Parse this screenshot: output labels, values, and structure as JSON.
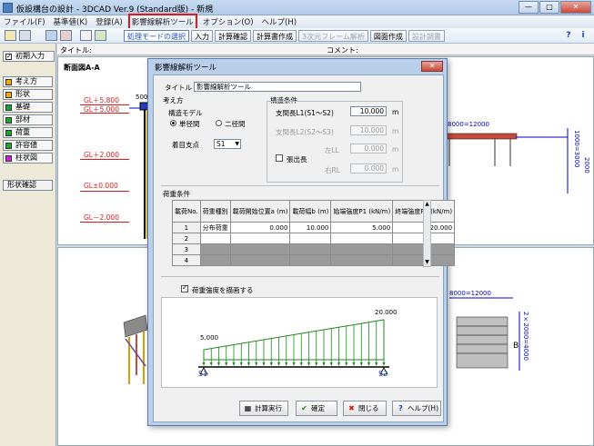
{
  "window": {
    "title": "仮設構台の設計 - 3DCAD Ver.9 (Standard版) - 新規",
    "buttons": {
      "minimize": "—",
      "maximize": "□",
      "close": "✕"
    }
  },
  "menu": [
    {
      "label": "ファイル(F)"
    },
    {
      "label": "基準値(K)"
    },
    {
      "label": "登録(A)"
    },
    {
      "label": "影響線解析ツール",
      "highlighted": true
    },
    {
      "label": "オプション(O)"
    },
    {
      "label": "ヘルプ(H)"
    }
  ],
  "toolbar": {
    "tabs": [
      {
        "label": "処理モードの選択",
        "state": "active"
      },
      {
        "label": "入力",
        "state": "normal"
      },
      {
        "label": "計算確認",
        "state": "normal"
      },
      {
        "label": "計算書作成",
        "state": "normal"
      },
      {
        "label": "3次元フレーム解析",
        "state": "disabled"
      },
      {
        "label": "図面作成",
        "state": "normal"
      },
      {
        "label": "設計調書",
        "state": "disabled"
      }
    ],
    "help_glyph": "?",
    "info_glyph": "i"
  },
  "left_panel": {
    "initial_input": "初期入力",
    "items": [
      {
        "label": "考え方",
        "color": "#f2a900"
      },
      {
        "label": "形状",
        "color": "#f2a900"
      },
      {
        "label": "基礎",
        "color": "#1aa52b"
      },
      {
        "label": "部材",
        "color": "#1aa52b"
      },
      {
        "label": "荷重",
        "color": "#1aa52b"
      },
      {
        "label": "許容値",
        "color": "#1aa52b"
      },
      {
        "label": "柱状図",
        "color": "#d61dd6"
      }
    ],
    "shape_check": "形状確認"
  },
  "infobar": {
    "title_label": "タイトル:",
    "comment_label": "コメント:"
  },
  "top_view": {
    "title": "断面図A-A",
    "gl_labels": [
      "GL＋5.800",
      "GL＋5.000",
      "GL＋2.000",
      "GL±0.000",
      "GL－2.000"
    ],
    "dim_500": "500",
    "dim_span": "8000=12000",
    "dim_vertical_1": "1000=3000",
    "dim_vertical_2": "2000"
  },
  "bottom_view": {
    "dim_span": "8000=12000",
    "dim_vertical": "2×2000=4000",
    "section_mark": "B"
  },
  "dialog": {
    "title": "影響線解析ツール",
    "close": "✕",
    "title_label": "タイトル",
    "title_value": "影響線解析ツール",
    "approach": {
      "heading": "考え方",
      "model_label": "構造モデル",
      "single_span": "単径間",
      "double_span": "二径間",
      "support_label": "着目支点",
      "support_value": "S1"
    },
    "structure": {
      "heading": "構造条件",
      "span1_label": "支間長L1(S1～S2)",
      "span1_value": "10.000",
      "span2_label": "支間長L2(S2～S3)",
      "span2_value": "10.000",
      "cantilever_label": "張出長",
      "left_label": "左LL",
      "left_value": "0.000",
      "right_label": "右RL",
      "right_value": "0.000",
      "unit": "m"
    },
    "load": {
      "heading": "荷重条件",
      "columns": [
        "載荷No.",
        "荷重種別",
        "載荷開始位置a (m)",
        "載荷幅b (m)",
        "始端強度P1 (kN/m)",
        "終端強度P2 (kN/m)"
      ],
      "rows": [
        {
          "no": "1",
          "type": "分布荷重",
          "a": "0.000",
          "b": "10.000",
          "p1": "5.000",
          "p2": "20.000"
        },
        {
          "no": "2",
          "type": "",
          "a": "",
          "b": "",
          "p1": "",
          "p2": ""
        },
        {
          "no": "3",
          "type": "",
          "a": "",
          "b": "",
          "p1": "",
          "p2": ""
        },
        {
          "no": "4",
          "type": "",
          "a": "",
          "b": "",
          "p1": "",
          "p2": ""
        }
      ],
      "draw_strength_label": "荷重強度を描画する"
    },
    "preview": {
      "p1_label": "5.000",
      "p2_label": "20.000",
      "s1_label": "S1",
      "s2_label": "S2",
      "p1": 5.0,
      "p2": 20.0
    },
    "buttons": {
      "calculate": "計算実行",
      "ok": "確定",
      "close": "閉じる",
      "help": "ヘルプ(H)"
    }
  }
}
